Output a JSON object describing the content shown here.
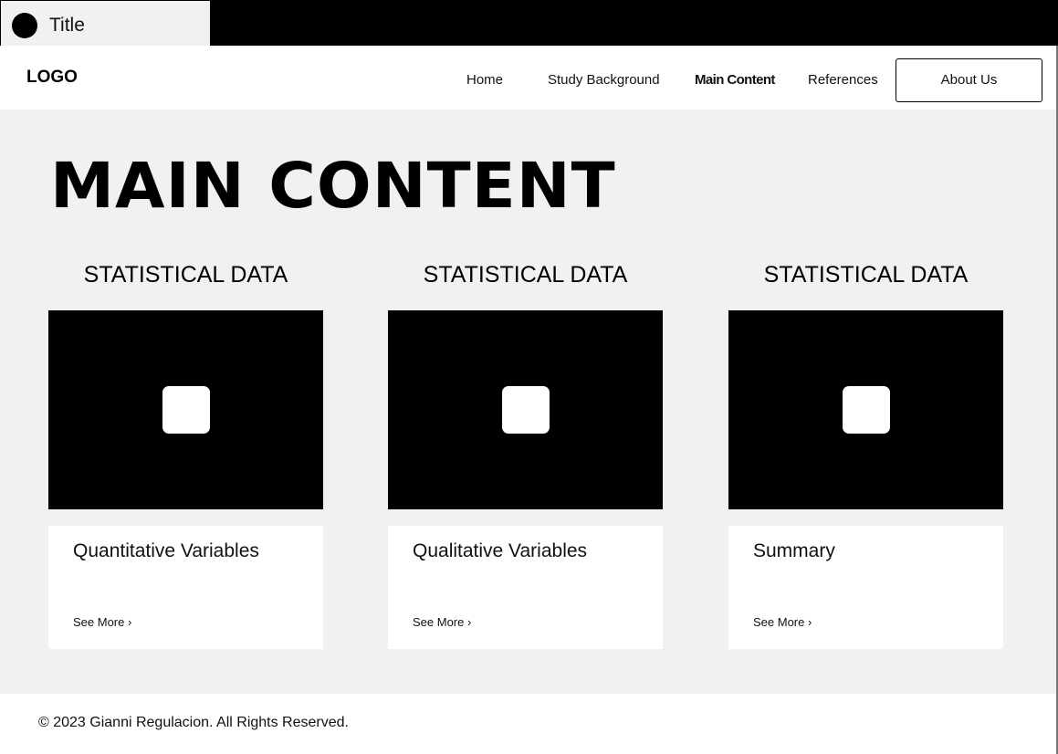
{
  "window": {
    "title": "Title"
  },
  "nav": {
    "logo": "LOGO",
    "links": [
      "Home",
      "Study Background",
      "Main Content",
      "References"
    ],
    "active": "Main Content",
    "button": "About Us"
  },
  "main": {
    "title": "MAIN CONTENT",
    "columns": [
      {
        "heading": "STATISTICAL DATA",
        "card_title": "Quantitative Variables",
        "link": "See More ›",
        "media_icon": "image-placeholder-icon"
      },
      {
        "heading": "STATISTICAL DATA",
        "card_title": "Qualitative Variables",
        "link": "See More ›",
        "media_icon": "image-placeholder-icon"
      },
      {
        "heading": "STATISTICAL DATA",
        "card_title": "Summary",
        "link": "See More ›",
        "media_icon": "image-placeholder-icon"
      }
    ]
  },
  "footer": {
    "copyright": "© 2023 Gianni Regulacion. All Rights Reserved."
  }
}
